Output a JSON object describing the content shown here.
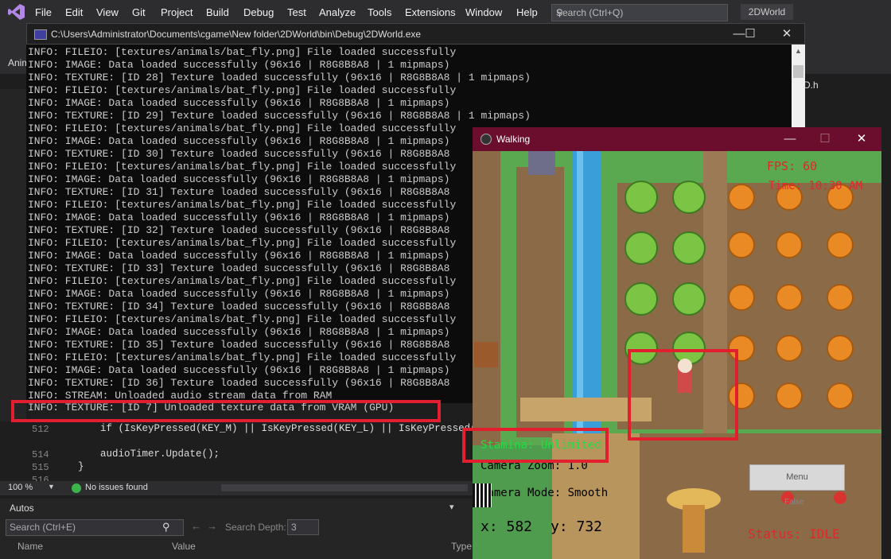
{
  "vs": {
    "menu": [
      "File",
      "Edit",
      "View",
      "Git",
      "Project",
      "Build",
      "Debug",
      "Test",
      "Analyze",
      "Tools",
      "Extensions",
      "Window",
      "Help"
    ],
    "search_placeholder": "Search (Ctrl+Q)",
    "project_name": "2DWorld",
    "side_tab_left": "Anim",
    "side_tab_right": "D.h",
    "editor_code": [
      {
        "no": "512",
        "text": "if (IsKeyPressed(KEY_M) || IsKeyPressed(KEY_L) || IsKeyPressed(KE"
      },
      {
        "no": "514",
        "text": "audioTimer.Update();"
      },
      {
        "no": "515",
        "text": "}"
      },
      {
        "no": "516",
        "text": ""
      }
    ],
    "zoom": "100 %",
    "issues": "No issues found",
    "autos": {
      "title": "Autos",
      "search_placeholder": "Search (Ctrl+E)",
      "search_depth_label": "Search Depth:",
      "search_depth_value": "3",
      "col_name": "Name",
      "col_value": "Value",
      "col_type": "Type"
    }
  },
  "console": {
    "title": "C:\\Users\\Administrator\\Documents\\cgame\\New folder\\2DWorld\\bin\\Debug\\2DWorld.exe",
    "lines": [
      "INFO: FILEIO: [textures/animals/bat_fly.png] File loaded successfully",
      "INFO: IMAGE: Data loaded successfully (96x16 | R8G8B8A8 | 1 mipmaps)",
      "INFO: TEXTURE: [ID 28] Texture loaded successfully (96x16 | R8G8B8A8 | 1 mipmaps)",
      "INFO: FILEIO: [textures/animals/bat_fly.png] File loaded successfully",
      "INFO: IMAGE: Data loaded successfully (96x16 | R8G8B8A8 | 1 mipmaps)",
      "INFO: TEXTURE: [ID 29] Texture loaded successfully (96x16 | R8G8B8A8 | 1 mipmaps)",
      "INFO: FILEIO: [textures/animals/bat_fly.png] File loaded successfully",
      "INFO: IMAGE: Data loaded successfully (96x16 | R8G8B8A8 | 1 mipmaps)",
      "INFO: TEXTURE: [ID 30] Texture loaded successfully (96x16 | R8G8B8A8",
      "INFO: FILEIO: [textures/animals/bat_fly.png] File loaded successfully",
      "INFO: IMAGE: Data loaded successfully (96x16 | R8G8B8A8 | 1 mipmaps)",
      "INFO: TEXTURE: [ID 31] Texture loaded successfully (96x16 | R8G8B8A8",
      "INFO: FILEIO: [textures/animals/bat_fly.png] File loaded successfully",
      "INFO: IMAGE: Data loaded successfully (96x16 | R8G8B8A8 | 1 mipmaps)",
      "INFO: TEXTURE: [ID 32] Texture loaded successfully (96x16 | R8G8B8A8",
      "INFO: FILEIO: [textures/animals/bat_fly.png] File loaded successfully",
      "INFO: IMAGE: Data loaded successfully (96x16 | R8G8B8A8 | 1 mipmaps)",
      "INFO: TEXTURE: [ID 33] Texture loaded successfully (96x16 | R8G8B8A8",
      "INFO: FILEIO: [textures/animals/bat_fly.png] File loaded successfully",
      "INFO: IMAGE: Data loaded successfully (96x16 | R8G8B8A8 | 1 mipmaps)",
      "INFO: TEXTURE: [ID 34] Texture loaded successfully (96x16 | R8G8B8A8",
      "INFO: FILEIO: [textures/animals/bat_fly.png] File loaded successfully",
      "INFO: IMAGE: Data loaded successfully (96x16 | R8G8B8A8 | 1 mipmaps)",
      "INFO: TEXTURE: [ID 35] Texture loaded successfully (96x16 | R8G8B8A8",
      "INFO: FILEIO: [textures/animals/bat_fly.png] File loaded successfully",
      "INFO: IMAGE: Data loaded successfully (96x16 | R8G8B8A8 | 1 mipmaps)",
      "INFO: TEXTURE: [ID 36] Texture loaded successfully (96x16 | R8G8B8A8",
      "INFO: STREAM: Unloaded audio stream data from RAM"
    ],
    "last_line": "INFO: TEXTURE: [ID 7] Unloaded texture data from VRAM (GPU)"
  },
  "game": {
    "title": "Walking",
    "fps": "FPS: 60",
    "time": "Time: 10:30 AM",
    "stamina": "Stamina: Unlimited",
    "camera_zoom": "Camera Zoom: 1.0",
    "camera_mode": "Camera Mode: Smooth",
    "pos_x": "x: 582",
    "pos_y": "y: 732",
    "menu_button": "Menu",
    "false_label": "False",
    "status": "Status: IDLE",
    "colors": {
      "titlebar": "#6b0e2e",
      "hud_red": "#e0282a",
      "hud_green": "#22dd44",
      "highlight": "#e21f2f"
    }
  }
}
